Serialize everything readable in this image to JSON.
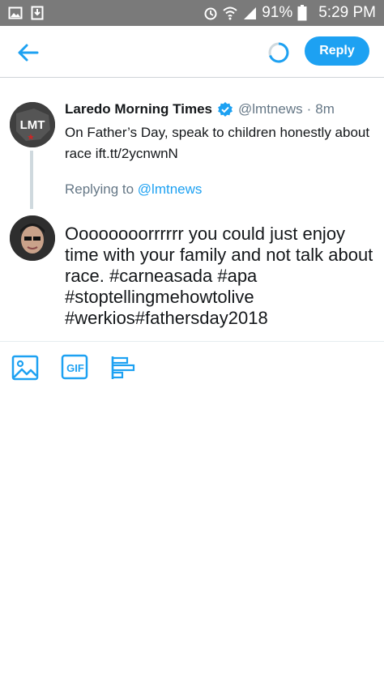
{
  "status_bar": {
    "battery_percent": "91%",
    "time": "5:29 PM",
    "icons": [
      "gallery-icon",
      "download-icon",
      "alarm-icon",
      "wifi-icon",
      "signal-icon",
      "battery-icon"
    ]
  },
  "header": {
    "reply_label": "Reply"
  },
  "original_tweet": {
    "display_name": "Laredo Morning Times",
    "handle": "@lmtnews",
    "separator": "·",
    "time_ago": "8m",
    "text": "On Father’s Day, speak to children honestly about race ift.tt/2ycnwnN",
    "avatar_text": "LMT"
  },
  "replying_to": {
    "prefix": "Replying to ",
    "handle": "@lmtnews"
  },
  "compose": {
    "text": "Oooooooorrrrrr you could just enjoy time with your family and not talk about race. #carneasada #apa #stoptellingmehowtolive #werkios#fathersday2018"
  },
  "toolbar": {
    "gif_label": "GIF"
  },
  "colors": {
    "accent": "#1da1f2",
    "status_bar": "#7a7a7a",
    "secondary_text": "#657786"
  }
}
